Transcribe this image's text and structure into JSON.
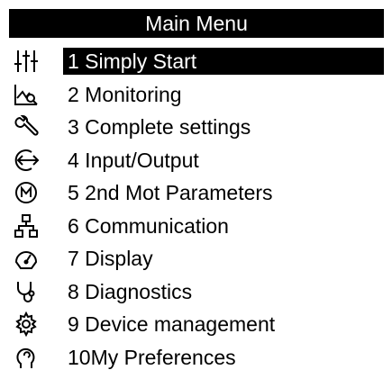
{
  "header": {
    "title": "Main Menu"
  },
  "menu": {
    "items": [
      {
        "label": "1 Simply Start",
        "icon": "sliders-icon",
        "selected": true
      },
      {
        "label": "2 Monitoring",
        "icon": "monitoring-chart-icon",
        "selected": false
      },
      {
        "label": "3 Complete settings",
        "icon": "wrench-icon",
        "selected": false
      },
      {
        "label": "4 Input/Output",
        "icon": "input-output-icon",
        "selected": false
      },
      {
        "label": "5 2nd Mot Parameters",
        "icon": "motor-icon",
        "selected": false
      },
      {
        "label": "6 Communication",
        "icon": "network-icon",
        "selected": false
      },
      {
        "label": "7 Display",
        "icon": "gauge-icon",
        "selected": false
      },
      {
        "label": "8 Diagnostics",
        "icon": "stethoscope-icon",
        "selected": false
      },
      {
        "label": "9 Device management",
        "icon": "gear-icon",
        "selected": false
      },
      {
        "label": "10My Preferences",
        "icon": "user-head-icon",
        "selected": false
      }
    ]
  },
  "colors": {
    "header_bg": "#000000",
    "header_text": "#ffffff",
    "selected_bg": "#000000",
    "text": "#000000"
  }
}
